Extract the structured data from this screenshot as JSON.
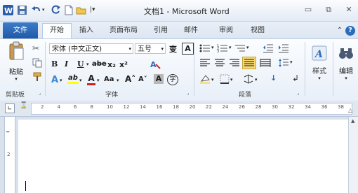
{
  "window": {
    "title": "文档1 - Microsoft Word",
    "minimize_glyph": "▭",
    "restore_glyph": "⧉",
    "close_glyph": "✕"
  },
  "quick_access": {
    "icons": [
      "word-logo-icon",
      "save-icon",
      "undo-icon",
      "redo-icon",
      "new-document-icon",
      "open-folder-icon",
      "customize-dropdown-icon"
    ]
  },
  "tabs": [
    "文件",
    "开始",
    "插入",
    "页面布局",
    "引用",
    "邮件",
    "审阅",
    "视图"
  ],
  "tab_extra": {
    "collapse_glyph": "⌃",
    "help_glyph": "?"
  },
  "ribbon": {
    "clipboard": {
      "paste": "粘贴",
      "cut_glyph": "✂",
      "label": "剪贴板"
    },
    "font": {
      "name": "宋体 (中文正文)",
      "size": "五号",
      "pinyin": "变",
      "border_char": "A",
      "bold": "B",
      "italic": "I",
      "underline": "U",
      "strikethrough": "abe",
      "subscript": "x₂",
      "superscript": "x²",
      "text_effect": "A",
      "highlight": "ab",
      "font_color": "A",
      "change_case": "Aa",
      "grow_font": "A˄",
      "shrink_font": "A˅",
      "char_shading": "A",
      "enclose_char": "字",
      "label": "字体"
    },
    "paragraph": {
      "label": "段落",
      "sort_glyph": "↓"
    },
    "styles": {
      "label": "样式"
    },
    "editing": {
      "label": "编辑"
    }
  },
  "ruler": {
    "numbers": [
      "2",
      "4",
      "6",
      "8",
      "10",
      "12",
      "14",
      "16",
      "18",
      "20",
      "22",
      "24",
      "26",
      "28",
      "30",
      "32",
      "34",
      "36",
      "38"
    ]
  },
  "colors": {
    "file_tab": "#2b6cb8",
    "highlight": "#ffff00",
    "font_color": "#d11f1f",
    "accent": "#2b6cb8"
  }
}
